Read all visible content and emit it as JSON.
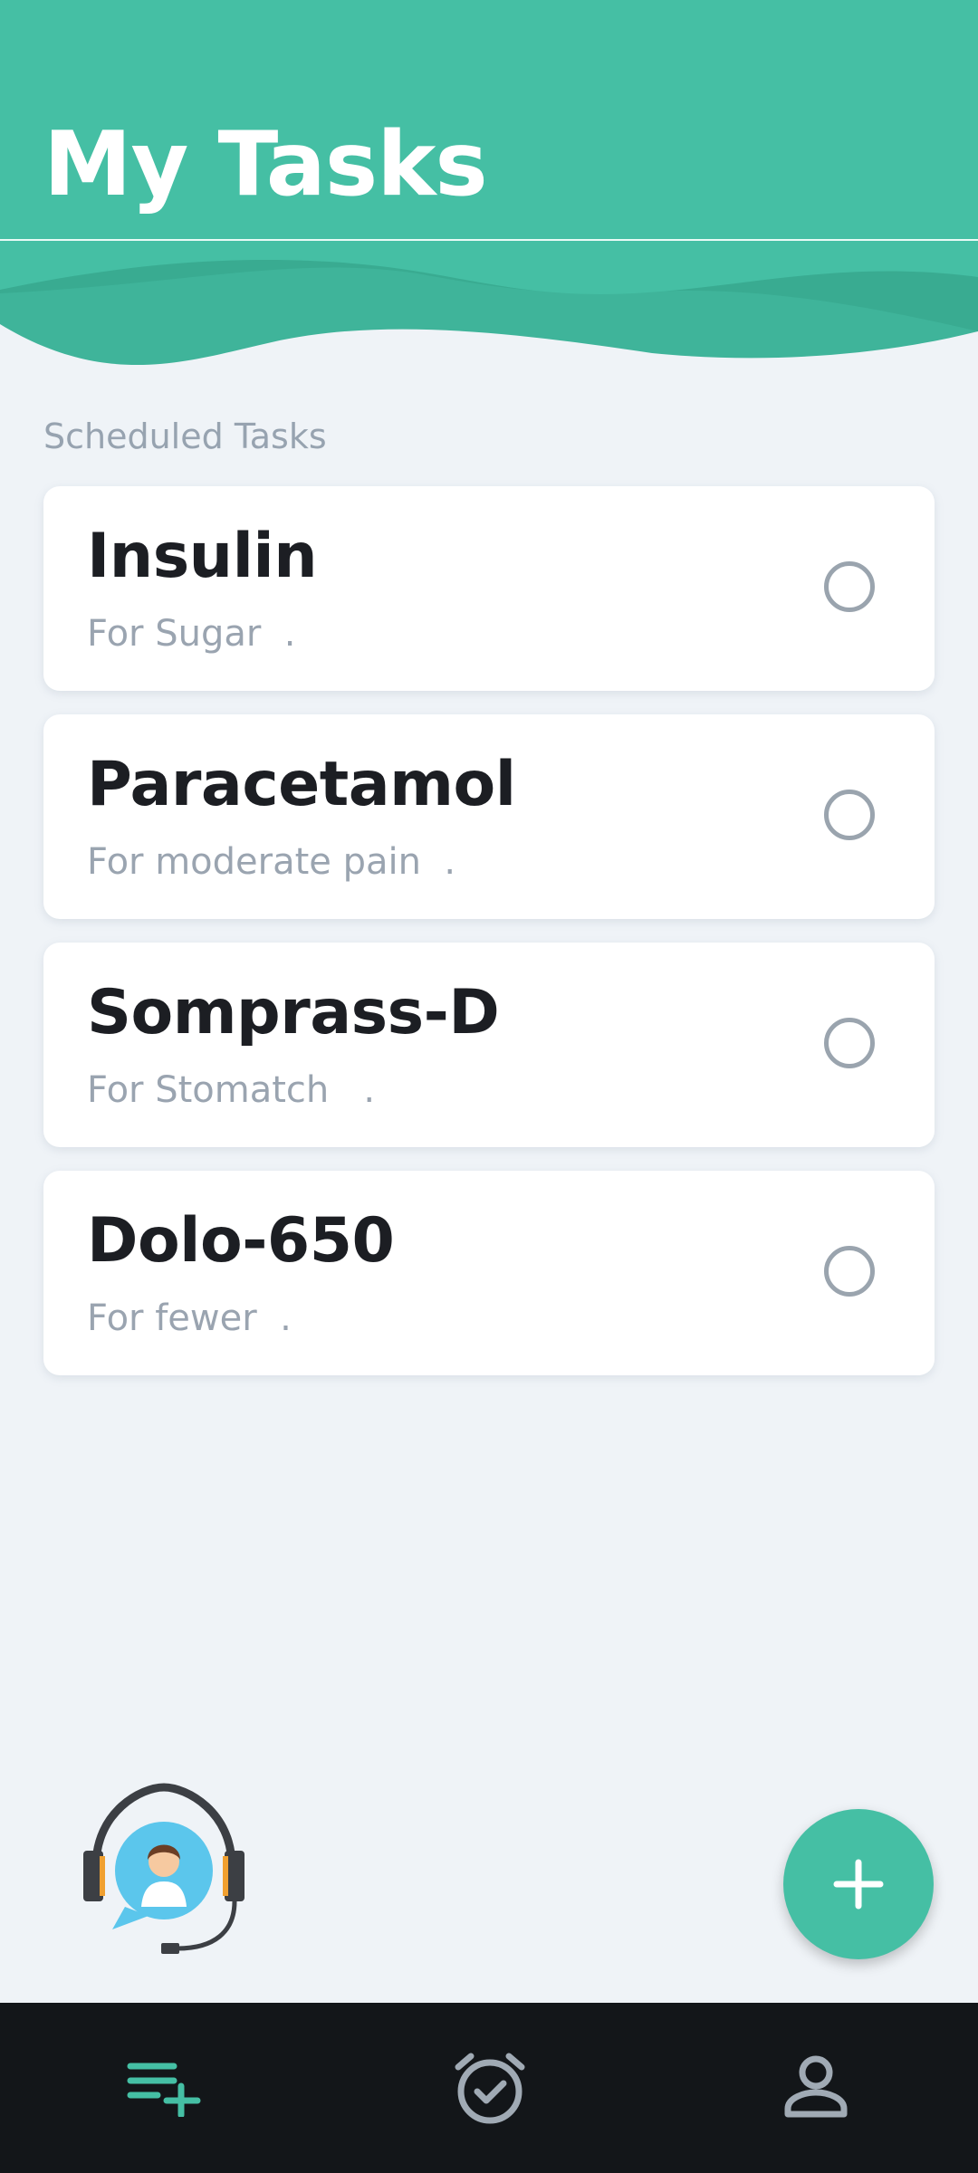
{
  "header": {
    "title": "My Tasks"
  },
  "section": {
    "label": "Scheduled Tasks"
  },
  "tasks": [
    {
      "name": "Insulin",
      "description": "For Sugar  ."
    },
    {
      "name": "Paracetamol",
      "description": "For moderate pain  ."
    },
    {
      "name": "Somprass-D",
      "description": "For Stomatch   ."
    },
    {
      "name": "Dolo-650",
      "description": "For fewer  ."
    }
  ],
  "icons": {
    "nav_tasks": "playlist-add-icon",
    "nav_alarm": "alarm-check-icon",
    "nav_profile": "person-icon",
    "fab": "plus-icon",
    "support": "support-agent-icon",
    "task_check": "circle-outline-icon"
  },
  "colors": {
    "accent": "#45bfa4",
    "background": "#eff3f7",
    "nav_background": "#131619",
    "nav_active": "#45bfa4",
    "nav_inactive": "#a0aab4"
  }
}
